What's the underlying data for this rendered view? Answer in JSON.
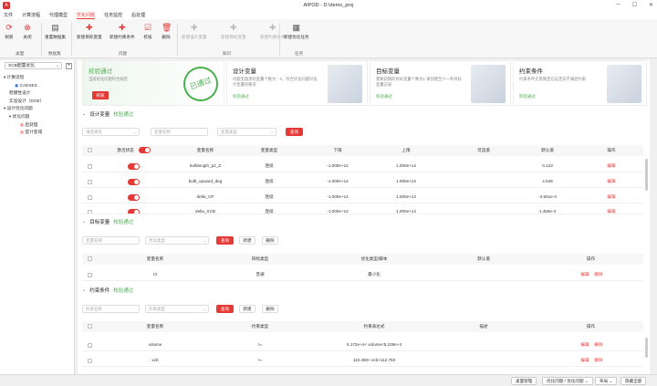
{
  "window": {
    "title": "AIPOD - D:\\demo_proj",
    "logo": "A"
  },
  "menu": [
    "文件",
    "计算流程",
    "代理模型",
    "优化问题",
    "任务监控",
    "后处理"
  ],
  "ribbon": {
    "groups": [
      {
        "label": "桌面"
      },
      {
        "label": "数据集"
      },
      {
        "label": "问题"
      },
      {
        "label": "知识"
      },
      {
        "label": "任务"
      }
    ],
    "buttons": {
      "refresh": "刷新",
      "close": "关闭",
      "reset_dataset": "重置数据集",
      "add_target": "新建目标变量",
      "add_constraint": "新建约束条件",
      "check": "校核",
      "delete": "删除",
      "new_design": "新建设计变量",
      "new_target_dis": "新建目标变量",
      "new_constraint_dis": "新建约束条件",
      "new_task": "新建优化任务"
    }
  },
  "sidebar": {
    "select": "XCB配置优化",
    "tree": [
      "计算流程",
      "CAESES",
      "稳健性设计",
      "实验设计（DOE）",
      "设计优化问题",
      "优化问题",
      "后处理",
      "提计变域"
    ]
  },
  "cards": [
    {
      "title": "校验通过",
      "desc": "当前优化问题符合规范",
      "button": "校核",
      "stamp": "已通过"
    },
    {
      "title": "设计变量",
      "desc": "问题里面测的变量个数为：6，符合优化问题对设计变量的要求",
      "link": "校验通过"
    },
    {
      "title": "目标变量",
      "desc": "需要前期的目标变量个数为1 请创建至少一条目标变量记录",
      "link": "校验通过"
    },
    {
      "title": "约束条件",
      "desc": "约束条件无等限定在设定成不满足约束",
      "link": "校验通过"
    }
  ],
  "design": {
    "title": "设计变量",
    "status": "校验通过",
    "filters": [
      "请选择名",
      "变量名称",
      "变量类型"
    ],
    "query": "查询",
    "headers": [
      "激活状态",
      "变量名称",
      "变量类型",
      "下限",
      "上限",
      "可选值",
      "默认值",
      "操作"
    ],
    "rows": [
      {
        "name": "bulblength_p2_Z",
        "type": "连续",
        "lower": "-1.000e+14",
        "upper": "1.000e+14",
        "options": "",
        "default": "0.123",
        "op": "编辑"
      },
      {
        "name": "bulb_upward_deg",
        "type": "连续",
        "lower": "-1.000e+14",
        "upper": "1.000e+14",
        "options": "",
        "default": "4.546",
        "op": "编辑"
      },
      {
        "name": "delta_CP",
        "type": "连续",
        "lower": "-1.000e+14",
        "upper": "1.000e+14",
        "options": "",
        "default": "-4.551e-3",
        "op": "编辑"
      },
      {
        "name": "delta_XCB",
        "type": "连续",
        "lower": "-1.000e+14",
        "upper": "1.000e+14",
        "options": "",
        "default": "1.455e-3",
        "op": "编辑"
      }
    ]
  },
  "target": {
    "title": "目标变量",
    "status": "校验通过",
    "filters": [
      "变量名称",
      "优化类型"
    ],
    "query": "查询",
    "new": "新建",
    "delete": "删除",
    "headers": [
      "变量名称",
      "目标类型",
      "优化类型/脚本",
      "默认值",
      "操作"
    ],
    "rows": [
      {
        "name": "Ct",
        "type": "普通",
        "opt": "最小化",
        "default": "",
        "edit": "编辑",
        "del": "删除"
      }
    ]
  },
  "constraint": {
    "title": "约束条件",
    "status": "校验通过",
    "filters": [
      "约束名称",
      "约束类型"
    ],
    "query": "查询",
    "new": "新建",
    "delete": "删除",
    "headers": [
      "变量名称",
      "约束类型",
      "约束表达式",
      "描述",
      "操作"
    ],
    "rows": [
      {
        "name": "volume",
        "type": ">=",
        "expr": "5.172e+4< volume<5.229e+4",
        "desc": "",
        "edit": "编辑",
        "del": "删除"
      },
      {
        "name": "xcb",
        "type": ">=",
        "expr": "110.450< xcb<112.750",
        "desc": "",
        "edit": "编辑",
        "del": "删除"
      }
    ]
  },
  "status": {
    "a": "桌面管理",
    "b": "优化问题 / 优化问题",
    "c": "布局",
    "d": "隐藏全部"
  }
}
